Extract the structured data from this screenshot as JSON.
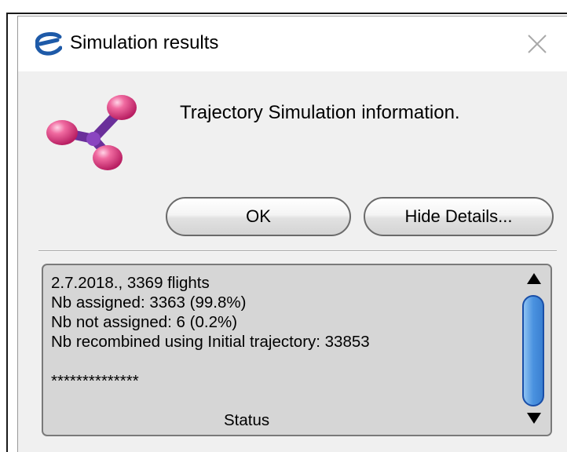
{
  "window": {
    "title": "Simulation results",
    "app_icon": "eurocontrol-e-icon",
    "close_icon": "close-icon"
  },
  "message": {
    "logo_icon": "molecule-logo-icon",
    "text": "Trajectory Simulation information."
  },
  "buttons": {
    "ok_label": "OK",
    "details_label": "Hide Details..."
  },
  "details": {
    "lines": [
      "2.7.2018., 3369 flights",
      "Nb assigned: 3363 (99.8%)",
      "Nb not assigned: 6 (0.2%)",
      "Nb recombined using Initial trajectory: 33853",
      "",
      "**************",
      "",
      "Status"
    ]
  },
  "colors": {
    "logo_pink": "#e8508a",
    "logo_purple": "#7a3aa8",
    "app_icon_blue": "#1e5aa8",
    "scroll_thumb": "#4a92e0"
  }
}
